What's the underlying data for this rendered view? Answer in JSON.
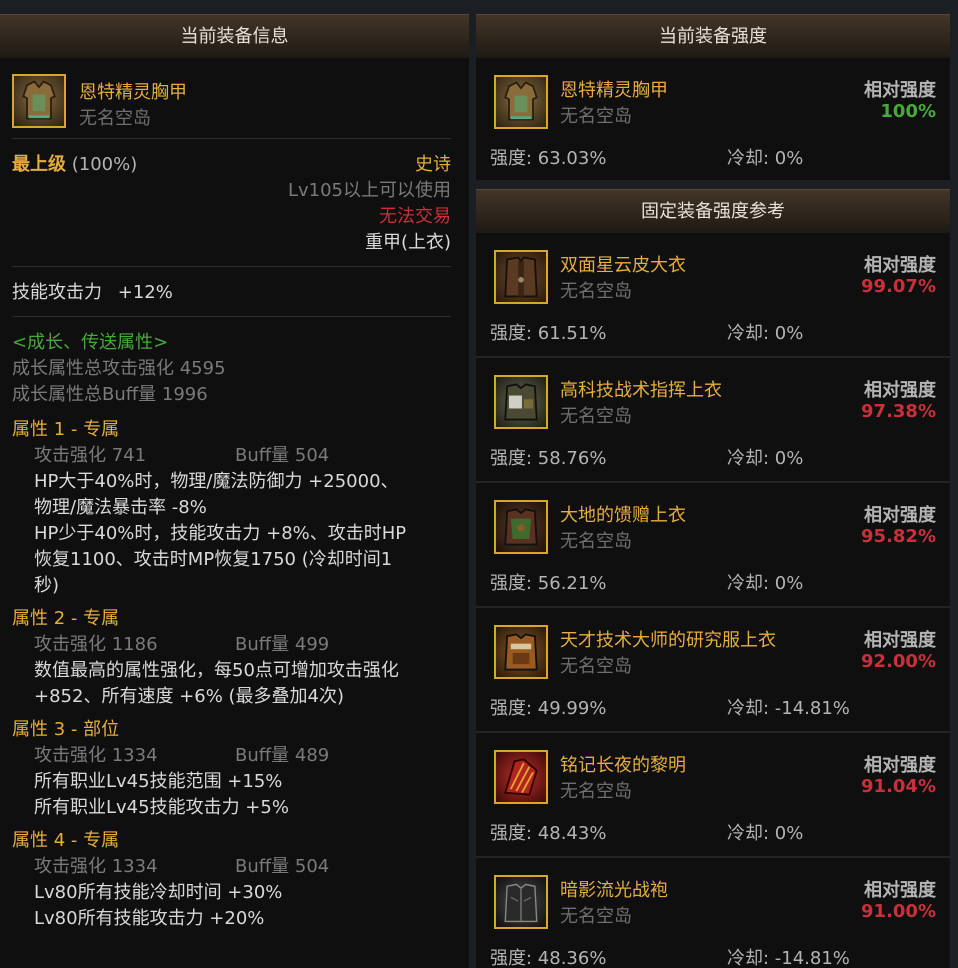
{
  "left_panel": {
    "title": "当前装备信息",
    "item_name": "恩特精灵胸甲",
    "item_source": "无名空岛",
    "grade_label": "最上级",
    "grade_pct": "(100%)",
    "rarity": "史诗",
    "level_req": "Lv105以上可以使用",
    "trade": "无法交易",
    "type": "重甲(上衣)",
    "skill_attack": "技能攻击力",
    "skill_attack_val": "+12%",
    "growth_header": "<成长、传送属性>",
    "growth_total_atk": "成长属性总攻击强化 4595",
    "growth_total_buff": "成长属性总Buff量 1996",
    "attrs": [
      {
        "title": "属性 1 - 专属",
        "atk": "攻击强化   741",
        "buff": "Buff量   504",
        "lines": [
          "HP大于40%时，物理/魔法防御力 +25000、",
          "物理/魔法暴击率 -8%",
          "HP少于40%时，技能攻击力 +8%、攻击时HP",
          "恢复1100、攻击时MP恢复1750 (冷却时间1",
          "秒)"
        ]
      },
      {
        "title": "属性 2 - 专属",
        "atk": "攻击强化   1186",
        "buff": "Buff量   499",
        "lines": [
          "数值最高的属性强化，每50点可增加攻击强化",
          "+852、所有速度 +6% (最多叠加4次)"
        ]
      },
      {
        "title": "属性 3 - 部位",
        "atk": "攻击强化   1334",
        "buff": "Buff量   489",
        "lines": [
          "所有职业Lv45技能范围 +15%",
          "所有职业Lv45技能攻击力 +5%"
        ]
      },
      {
        "title": "属性 4 - 专属",
        "atk": "攻击强化   1334",
        "buff": "Buff量   504",
        "lines": [
          "Lv80所有技能冷却时间 +30%",
          "Lv80所有技能攻击力 +20%"
        ]
      }
    ]
  },
  "current_panel": {
    "title": "当前装备强度",
    "item": {
      "name": "恩特精灵胸甲",
      "source": "无名空岛",
      "rel_label": "相对强度",
      "rel_value": "100%",
      "strength": "强度: 63.03%",
      "cooldown": "冷却: 0%"
    }
  },
  "reference_panel": {
    "title": "固定装备强度参考",
    "items": [
      {
        "name": "双面星云皮大衣",
        "source": "无名空岛",
        "rel_label": "相对强度",
        "rel_value": "99.07%",
        "strength": "强度: 61.51%",
        "cooldown": "冷却: 0%",
        "icon": "coat-icon"
      },
      {
        "name": "高科技战术指挥上衣",
        "source": "无名空岛",
        "rel_label": "相对强度",
        "rel_value": "97.38%",
        "strength": "强度: 58.76%",
        "cooldown": "冷却: 0%",
        "icon": "tactical-vest-icon"
      },
      {
        "name": "大地的馈赠上衣",
        "source": "无名空岛",
        "rel_label": "相对强度",
        "rel_value": "95.82%",
        "strength": "强度: 56.21%",
        "cooldown": "冷却: 0%",
        "icon": "earth-armor-icon"
      },
      {
        "name": "天才技术大师的研究服上衣",
        "source": "无名空岛",
        "rel_label": "相对强度",
        "rel_value": "92.00%",
        "strength": "强度: 49.99%",
        "cooldown": "冷却: -14.81%",
        "icon": "lab-suit-icon"
      },
      {
        "name": "铭记长夜的黎明",
        "source": "无名空岛",
        "rel_label": "相对强度",
        "rel_value": "91.04%",
        "strength": "强度: 48.43%",
        "cooldown": "冷却: 0%",
        "icon": "dawn-robe-icon"
      },
      {
        "name": "暗影流光战袍",
        "source": "无名空岛",
        "rel_label": "相对强度",
        "rel_value": "91.00%",
        "strength": "强度: 48.36%",
        "cooldown": "冷却: -14.81%",
        "icon": "shadow-robe-icon"
      }
    ]
  },
  "colors": {
    "gold": "#e5ad3e",
    "red": "#c8303a",
    "green": "#49a83b",
    "header_bg": "#3a2e22"
  }
}
